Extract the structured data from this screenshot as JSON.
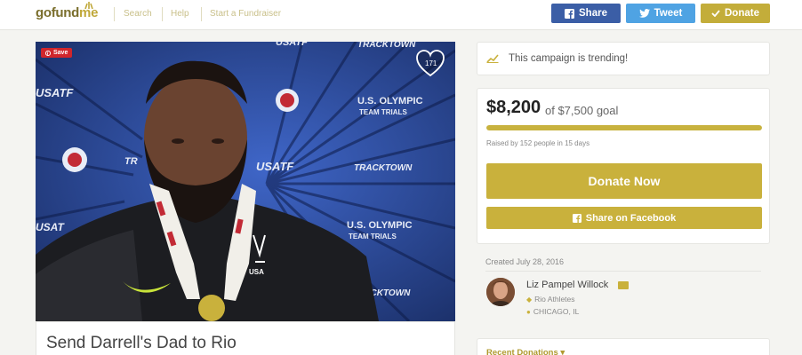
{
  "header": {
    "logo_part1": "go",
    "logo_part2": "fund",
    "logo_part3": "me",
    "nav": [
      "Search",
      "Help",
      "Start a Fundraiser"
    ],
    "share_label": "Share",
    "tweet_label": "Tweet",
    "donate_label": "Donate"
  },
  "media": {
    "save_label": "Save",
    "heart_count": "171"
  },
  "campaign": {
    "title": "Send Darrell's Dad to Rio"
  },
  "trending": {
    "text": "This campaign is trending!"
  },
  "goal": {
    "amount": "$8,200",
    "goal_text": "of $7,500 goal",
    "progress_fraction": 1.0,
    "raised_text": "Raised by 152 people in 15 days",
    "donate_now_label": "Donate Now",
    "share_fb_label": "Share on Facebook"
  },
  "organizer": {
    "created": "Created July 28, 2016",
    "name": "Liz Pampel Willock",
    "category": "Rio Athletes",
    "location": "CHICAGO, IL"
  },
  "recent": {
    "label": "Recent Donations"
  },
  "colors": {
    "brand_gold": "#c9b13c",
    "facebook_blue": "#3b5ea6",
    "twitter_blue": "#4fa3e3"
  }
}
